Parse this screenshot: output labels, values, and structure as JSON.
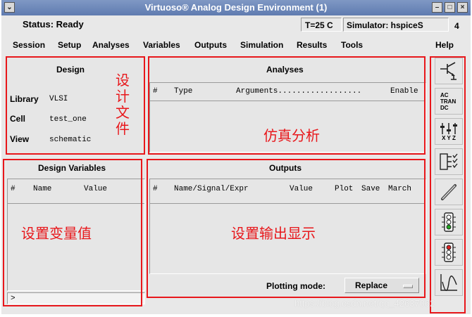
{
  "window": {
    "title": "Virtuoso® Analog Design Environment (1)"
  },
  "status": {
    "text": "Status: Ready",
    "temp": "T=25 C",
    "simulator": "Simulator: hspiceS",
    "num": "4"
  },
  "menu": {
    "items": [
      "Session",
      "Setup",
      "Analyses",
      "Variables",
      "Outputs",
      "Simulation",
      "Results",
      "Tools"
    ],
    "help": "Help"
  },
  "design": {
    "title": "Design",
    "library_label": "Library",
    "library_value": "VLSI",
    "cell_label": "Cell",
    "cell_value": "test_one",
    "view_label": "View",
    "view_value": "schematic",
    "annotation": "设\n计\n文\n件"
  },
  "analyses": {
    "title": "Analyses",
    "col_num": "#",
    "col_type": "Type",
    "col_args": "Arguments..................",
    "col_enable": "Enable",
    "annotation": "仿真分析"
  },
  "design_variables": {
    "title": "Design Variables",
    "col_num": "#",
    "col_name": "Name",
    "col_value": "Value",
    "annotation": "设置变量值",
    "prompt": ">"
  },
  "outputs": {
    "title": "Outputs",
    "col_num": "#",
    "col_name": "Name/Signal/Expr",
    "col_value": "Value",
    "col_plot": "Plot",
    "col_save": "Save",
    "col_march": "March",
    "annotation": "设置输出显示",
    "plotting_mode_label": "Plotting mode:",
    "plotting_mode_value": "Replace"
  },
  "toolbar": {
    "ac": "AC",
    "tran": "TRAN",
    "dc": "DC",
    "xyz": "X Y Z"
  },
  "watermark": "https://blog.csdn.net/qq_42637062",
  "colors": {
    "annotation_red": "#e8171b",
    "titlebar": "#6a84b8",
    "panel": "#e6e6e6"
  }
}
